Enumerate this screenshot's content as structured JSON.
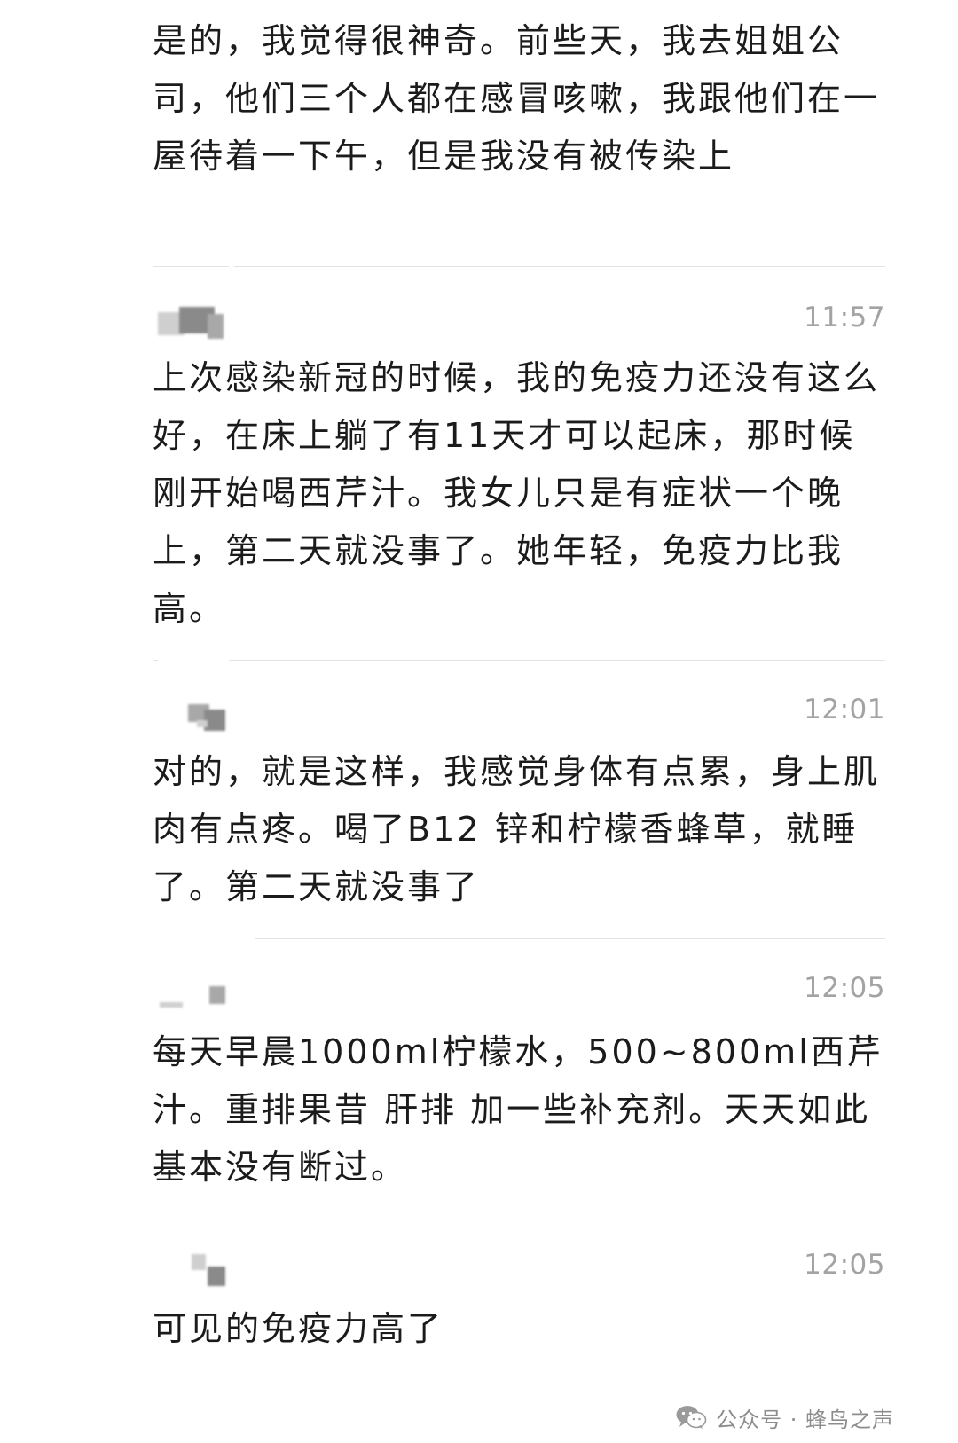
{
  "messages": [
    {
      "time": "",
      "text": "是的，我觉得很神奇。前些天，我去姐姐公司，他们三个人都在感冒咳嗽，我跟他们在一屋待着一下午，但是我没有被传染上"
    },
    {
      "time": "11:57",
      "text": "上次感染新冠的时候，我的免疫力还没有这么好，在床上躺了有11天才可以起床，那时候刚开始喝西芹汁。我女儿只是有症状一个晚上，第二天就没事了。她年轻，免疫力比我高。"
    },
    {
      "time": "12:01",
      "text": "对的，就是这样，我感觉身体有点累，身上肌肉有点疼。喝了B12 锌和柠檬香蜂草，就睡了。第二天就没事了"
    },
    {
      "time": "12:05",
      "text": "每天早晨1000ml柠檬水，500~800ml西芹汁。重排果昔 肝排 加一些补充剂。天天如此 基本没有断过。"
    },
    {
      "time": "12:05",
      "text": "可见的免疫力高了"
    }
  ],
  "watermark": {
    "icon": "wechat-icon",
    "text": "公众号 · 蜂鸟之声"
  }
}
